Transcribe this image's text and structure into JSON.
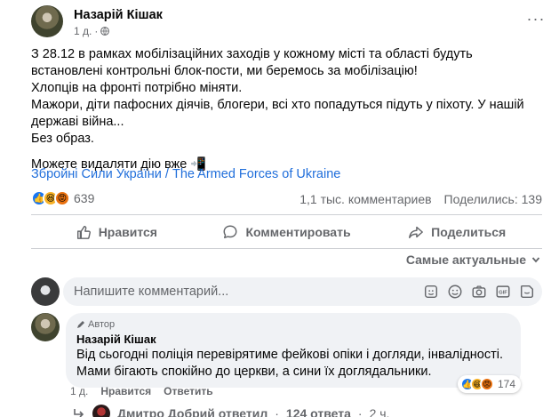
{
  "post": {
    "author": "Назарій Кішак",
    "time": "1 д.",
    "separator": "·",
    "more": "···",
    "paragraphs": [
      "З 28.12 в рамках мобілізаційних заходів у кожному місті та області будуть встановлені контрольні блок-пости, ми беремось за мобілізацію!\nХлопців на фронті потрібно міняти.\nМажори, діти пафосних діячів, блогери, всі хто попадуться підуть у піхоту. У нашій державі війна...\nБез образ.",
      "Можете видаляти дію вже 📲"
    ],
    "link": "Збройні Сили України / The Armed Forces of Ukraine",
    "reaction_count": "639",
    "comments_count": "1,1 тыс. комментариев",
    "shares_count": "Поделились: 139"
  },
  "actions": {
    "like": "Нравится",
    "comment": "Комментировать",
    "share": "Поделиться"
  },
  "sort_label": "Самые актуальные",
  "composer": {
    "placeholder": "Напишите комментарий..."
  },
  "comment": {
    "badge": "Автор",
    "author": "Назарій Кішак",
    "text": "Від сьогодні поліція перевірятиме фейкові опіки і догляди, інвалідності. Мами бігають спокійно до церкви, а сини їх доглядальники.",
    "time": "1 д.",
    "like": "Нравится",
    "reply": "Ответить",
    "reaction_count": "174"
  },
  "replies": {
    "name": "Дмитро Добрий ответил",
    "separator": "·",
    "count": "124 ответа",
    "dot": "·",
    "time": "2 ч."
  },
  "colors": {
    "link": "#216fdb",
    "secondary_text": "#65676b",
    "like_blue": "#1877f2",
    "comment_bg": "#f0f2f5"
  }
}
